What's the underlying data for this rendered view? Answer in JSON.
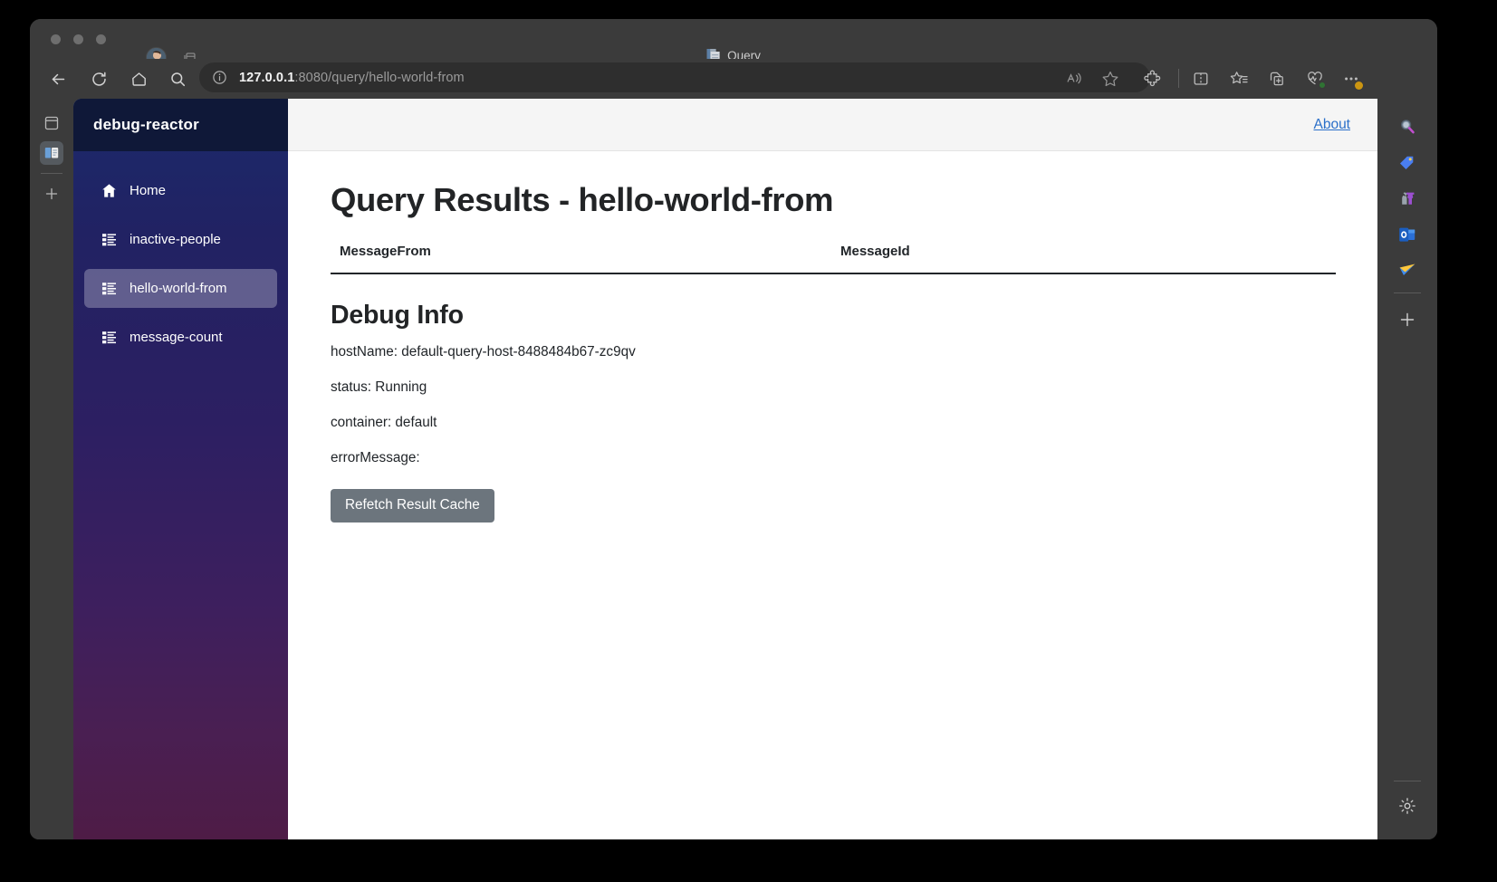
{
  "browser": {
    "tab_title": "Query",
    "tab_icon": "document-icon",
    "url_host": "127.0.0.1",
    "url_path": ":8080/query/hello-world-from",
    "back_icon": "back-arrow-icon",
    "reload_icon": "reload-icon",
    "home_icon": "home-icon",
    "search_icon": "search-icon",
    "info_icon": "info-icon",
    "read_aloud_icon": "read-aloud-icon",
    "favorite_icon": "star-icon",
    "extensions_icon": "extensions-puzzle-icon",
    "split_screen_icon": "split-screen-icon",
    "collections_icon": "collections-star-icon",
    "add_page_icon": "add-page-icon",
    "browser_essentials_icon": "browser-essentials-heart-icon",
    "more_icon": "more-ellipsis-icon",
    "copilot_icon": "copilot-icon",
    "profile_icon": "profile-avatar-icon",
    "tab_search_icon": "tab-actions-icon"
  },
  "left_strip": {
    "workspaces_icon": "workspaces-icon",
    "split_tabs_icon": "split-tabs-icon",
    "add_icon": "plus-icon"
  },
  "right_bar": {
    "icons": [
      {
        "name": "search-bing-icon"
      },
      {
        "name": "shopping-tag-icon"
      },
      {
        "name": "games-icon"
      },
      {
        "name": "outlook-icon"
      },
      {
        "name": "send-plane-icon"
      },
      {
        "name": "plus-icon"
      },
      {
        "name": "settings-gear-icon"
      }
    ]
  },
  "sidebar": {
    "brand": "debug-reactor",
    "items": [
      {
        "label": "Home",
        "icon": "home-icon",
        "active": false
      },
      {
        "label": "inactive-people",
        "icon": "list-icon",
        "active": false
      },
      {
        "label": "hello-world-from",
        "icon": "list-icon",
        "active": true
      },
      {
        "label": "message-count",
        "icon": "list-icon",
        "active": false
      }
    ]
  },
  "topbar": {
    "about_label": "About"
  },
  "main": {
    "page_title": "Query Results - hello-world-from",
    "table": {
      "columns": [
        "MessageFrom",
        "MessageId"
      ],
      "rows": []
    },
    "debug": {
      "title": "Debug Info",
      "fields": [
        "hostName: default-query-host-8488484b67-zc9qv",
        "status: Running",
        "container: default",
        "errorMessage:"
      ],
      "refetch_label": "Refetch Result Cache"
    }
  },
  "colors": {
    "accent_link": "#2a6fc9",
    "sidebar_top": "#1b2a6b",
    "sidebar_bottom": "#4e1c46",
    "brand_bar": "#0f1838",
    "button_gray": "#6c757d"
  }
}
